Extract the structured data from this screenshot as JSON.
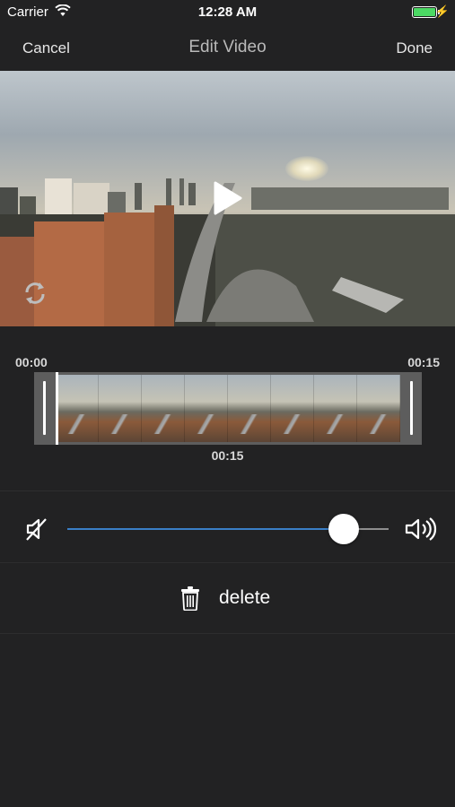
{
  "status_bar": {
    "carrier": "Carrier",
    "time": "12:28 AM"
  },
  "nav": {
    "cancel_label": "Cancel",
    "title": "Edit Video",
    "done_label": "Done"
  },
  "trim": {
    "start_time": "00:00",
    "end_time": "00:15",
    "current_time": "00:15"
  },
  "volume": {
    "level": 0.86
  },
  "actions": {
    "delete_label": "delete"
  },
  "colors": {
    "background": "#222223",
    "slider_accent": "#3a7fc6",
    "battery": "#4cd964"
  },
  "icons": {
    "wifi": "wifi-icon",
    "battery": "battery-icon",
    "play": "play-icon",
    "loop": "loop-icon",
    "mute": "speaker-mute-icon",
    "volume": "speaker-loud-icon",
    "trash": "trash-icon"
  }
}
